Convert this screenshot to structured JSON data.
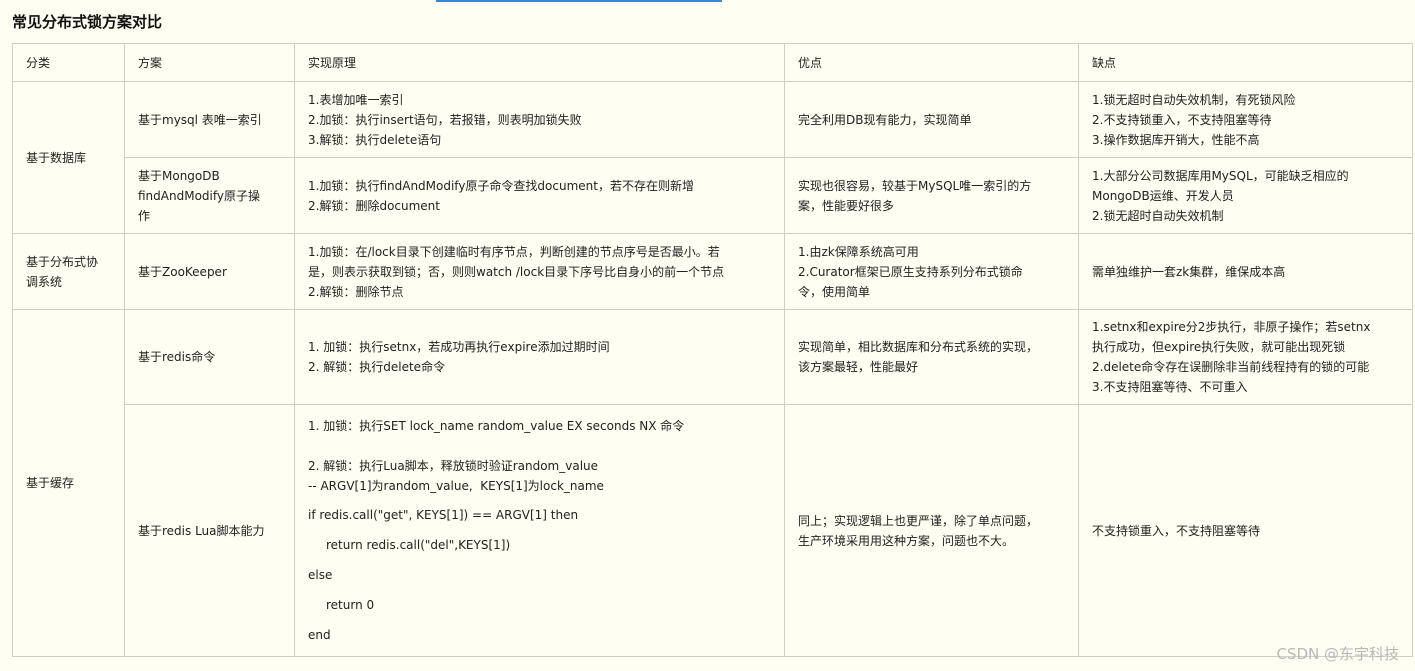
{
  "title": "常见分布式锁方案对比",
  "headers": [
    "分类",
    "方案",
    "实现原理",
    "优点",
    "缺点"
  ],
  "groups": [
    {
      "category": "基于数据库",
      "rows": [
        {
          "scheme": "基于mysql 表唯一索引",
          "principle": [
            "1.表增加唯一索引",
            "2.加锁：执行insert语句，若报错，则表明加锁失败",
            "3.解锁：执行delete语句"
          ],
          "pros": [
            "完全利用DB现有能力，实现简单"
          ],
          "cons": [
            "1.锁无超时自动失效机制，有死锁风险",
            "2.不支持锁重入，不支持阻塞等待",
            "3.操作数据库开销大，性能不高"
          ]
        },
        {
          "scheme": [
            "基于MongoDB",
            "findAndModify原子操",
            "作"
          ],
          "principle": [
            "1.加锁：执行findAndModify原子命令查找document，若不存在则新增",
            "2.解锁：删除document"
          ],
          "pros": [
            "实现也很容易，较基于MySQL唯一索引的方",
            "案，性能要好很多"
          ],
          "cons": [
            "1.大部分公司数据库用MySQL，可能缺乏相应的",
            "MongoDB运维、开发人员",
            "2.锁无超时自动失效机制"
          ]
        }
      ]
    },
    {
      "category": [
        "基于分布式协",
        "调系统"
      ],
      "rows": [
        {
          "scheme": "基于ZooKeeper",
          "principle": [
            "1.加锁：在/lock目录下创建临时有序节点，判断创建的节点序号是否最小。若",
            "是，则表示获取到锁；否，则则watch /lock目录下序号比自身小的前一个节点",
            "2.解锁：删除节点"
          ],
          "pros": [
            "1.由zk保障系统高可用",
            "2.Curator框架已原生支持系列分布式锁命",
            "令，使用简单"
          ],
          "cons": [
            "需单独维护一套zk集群，维保成本高"
          ]
        }
      ]
    },
    {
      "category": "基于缓存",
      "rows": [
        {
          "scheme": "基于redis命令",
          "principle": [
            "1. 加锁：执行setnx，若成功再执行expire添加过期时间",
            "2. 解锁：执行delete命令"
          ],
          "pros": [
            "实现简单，相比数据库和分布式系统的实现，",
            "该方案最轻，性能最好"
          ],
          "cons": [
            "1.setnx和expire分2步执行，非原子操作；若setnx",
            "执行成功，但expire执行失败，就可能出现死锁",
            "2.delete命令存在误删除非当前线程持有的锁的可能",
            "3.不支持阻塞等待、不可重入"
          ]
        },
        {
          "scheme": "基于redis Lua脚本能力",
          "principle_lines": {
            "l1": "1. 加锁：执行SET lock_name random_value EX seconds NX 命令",
            "l2": "2. 解锁：执行Lua脚本，释放锁时验证random_value",
            "l3": "-- ARGV[1]为random_value,  KEYS[1]为lock_name",
            "l4": "if redis.call(\"get\", KEYS[1]) == ARGV[1] then",
            "l5": "return redis.call(\"del\",KEYS[1])",
            "l6": "else",
            "l7": "return 0",
            "l8": "end"
          },
          "pros": [
            "同上；实现逻辑上也更严谨，除了单点问题，",
            "生产环境采用用这种方案，问题也不大。"
          ],
          "cons": [
            "不支持锁重入，不支持阻塞等待"
          ]
        }
      ]
    }
  ],
  "watermark": "CSDN @东宇科技"
}
